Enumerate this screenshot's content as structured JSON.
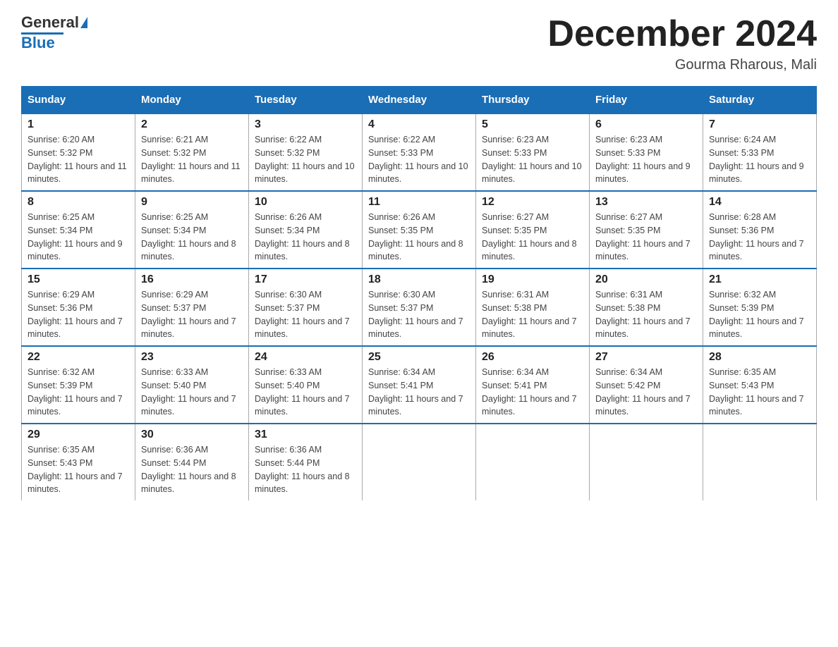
{
  "logo": {
    "general": "General",
    "blue": "Blue"
  },
  "header": {
    "month": "December 2024",
    "location": "Gourma Rharous, Mali"
  },
  "days_of_week": [
    "Sunday",
    "Monday",
    "Tuesday",
    "Wednesday",
    "Thursday",
    "Friday",
    "Saturday"
  ],
  "weeks": [
    [
      {
        "day": "1",
        "sunrise": "6:20 AM",
        "sunset": "5:32 PM",
        "daylight": "11 hours and 11 minutes."
      },
      {
        "day": "2",
        "sunrise": "6:21 AM",
        "sunset": "5:32 PM",
        "daylight": "11 hours and 11 minutes."
      },
      {
        "day": "3",
        "sunrise": "6:22 AM",
        "sunset": "5:32 PM",
        "daylight": "11 hours and 10 minutes."
      },
      {
        "day": "4",
        "sunrise": "6:22 AM",
        "sunset": "5:33 PM",
        "daylight": "11 hours and 10 minutes."
      },
      {
        "day": "5",
        "sunrise": "6:23 AM",
        "sunset": "5:33 PM",
        "daylight": "11 hours and 10 minutes."
      },
      {
        "day": "6",
        "sunrise": "6:23 AM",
        "sunset": "5:33 PM",
        "daylight": "11 hours and 9 minutes."
      },
      {
        "day": "7",
        "sunrise": "6:24 AM",
        "sunset": "5:33 PM",
        "daylight": "11 hours and 9 minutes."
      }
    ],
    [
      {
        "day": "8",
        "sunrise": "6:25 AM",
        "sunset": "5:34 PM",
        "daylight": "11 hours and 9 minutes."
      },
      {
        "day": "9",
        "sunrise": "6:25 AM",
        "sunset": "5:34 PM",
        "daylight": "11 hours and 8 minutes."
      },
      {
        "day": "10",
        "sunrise": "6:26 AM",
        "sunset": "5:34 PM",
        "daylight": "11 hours and 8 minutes."
      },
      {
        "day": "11",
        "sunrise": "6:26 AM",
        "sunset": "5:35 PM",
        "daylight": "11 hours and 8 minutes."
      },
      {
        "day": "12",
        "sunrise": "6:27 AM",
        "sunset": "5:35 PM",
        "daylight": "11 hours and 8 minutes."
      },
      {
        "day": "13",
        "sunrise": "6:27 AM",
        "sunset": "5:35 PM",
        "daylight": "11 hours and 7 minutes."
      },
      {
        "day": "14",
        "sunrise": "6:28 AM",
        "sunset": "5:36 PM",
        "daylight": "11 hours and 7 minutes."
      }
    ],
    [
      {
        "day": "15",
        "sunrise": "6:29 AM",
        "sunset": "5:36 PM",
        "daylight": "11 hours and 7 minutes."
      },
      {
        "day": "16",
        "sunrise": "6:29 AM",
        "sunset": "5:37 PM",
        "daylight": "11 hours and 7 minutes."
      },
      {
        "day": "17",
        "sunrise": "6:30 AM",
        "sunset": "5:37 PM",
        "daylight": "11 hours and 7 minutes."
      },
      {
        "day": "18",
        "sunrise": "6:30 AM",
        "sunset": "5:37 PM",
        "daylight": "11 hours and 7 minutes."
      },
      {
        "day": "19",
        "sunrise": "6:31 AM",
        "sunset": "5:38 PM",
        "daylight": "11 hours and 7 minutes."
      },
      {
        "day": "20",
        "sunrise": "6:31 AM",
        "sunset": "5:38 PM",
        "daylight": "11 hours and 7 minutes."
      },
      {
        "day": "21",
        "sunrise": "6:32 AM",
        "sunset": "5:39 PM",
        "daylight": "11 hours and 7 minutes."
      }
    ],
    [
      {
        "day": "22",
        "sunrise": "6:32 AM",
        "sunset": "5:39 PM",
        "daylight": "11 hours and 7 minutes."
      },
      {
        "day": "23",
        "sunrise": "6:33 AM",
        "sunset": "5:40 PM",
        "daylight": "11 hours and 7 minutes."
      },
      {
        "day": "24",
        "sunrise": "6:33 AM",
        "sunset": "5:40 PM",
        "daylight": "11 hours and 7 minutes."
      },
      {
        "day": "25",
        "sunrise": "6:34 AM",
        "sunset": "5:41 PM",
        "daylight": "11 hours and 7 minutes."
      },
      {
        "day": "26",
        "sunrise": "6:34 AM",
        "sunset": "5:41 PM",
        "daylight": "11 hours and 7 minutes."
      },
      {
        "day": "27",
        "sunrise": "6:34 AM",
        "sunset": "5:42 PM",
        "daylight": "11 hours and 7 minutes."
      },
      {
        "day": "28",
        "sunrise": "6:35 AM",
        "sunset": "5:43 PM",
        "daylight": "11 hours and 7 minutes."
      }
    ],
    [
      {
        "day": "29",
        "sunrise": "6:35 AM",
        "sunset": "5:43 PM",
        "daylight": "11 hours and 7 minutes."
      },
      {
        "day": "30",
        "sunrise": "6:36 AM",
        "sunset": "5:44 PM",
        "daylight": "11 hours and 8 minutes."
      },
      {
        "day": "31",
        "sunrise": "6:36 AM",
        "sunset": "5:44 PM",
        "daylight": "11 hours and 8 minutes."
      },
      null,
      null,
      null,
      null
    ]
  ]
}
